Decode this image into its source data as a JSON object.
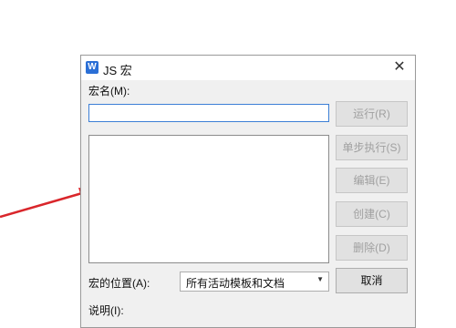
{
  "dialog": {
    "title": "JS 宏",
    "icon_name": "wps-app-icon",
    "close_glyph": "✕",
    "name_label": "宏名(M):",
    "name_value": "",
    "buttons": {
      "run": "运行(R)",
      "step": "单步执行(S)",
      "edit": "编辑(E)",
      "create": "创建(C)",
      "delete": "删除(D)",
      "cancel": "取消"
    },
    "location_label": "宏的位置(A):",
    "location_value": "所有活动模板和文档",
    "description_label": "说明(I):"
  },
  "annotation": {
    "arrow_color": "#d9262b"
  }
}
